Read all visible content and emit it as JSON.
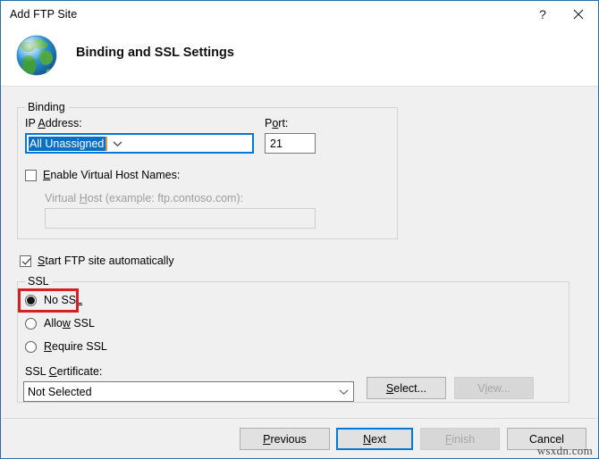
{
  "window": {
    "title": "Add FTP Site",
    "help_icon": "question-mark-icon",
    "close_icon": "close-icon"
  },
  "header": {
    "icon": "globe-icon",
    "title": "Binding and SSL Settings"
  },
  "binding": {
    "legend": "Binding",
    "ip_address_label": "IP Address:",
    "ip_address_value": "All Unassigned",
    "port_label": "Port:",
    "port_value": "21",
    "enable_virtual_host_label": "Enable Virtual Host Names:",
    "enable_virtual_host_checked": false,
    "virtual_host_label": "Virtual Host (example: ftp.contoso.com):",
    "virtual_host_value": "",
    "virtual_host_enabled": false
  },
  "start_automatically": {
    "label": "Start FTP site automatically",
    "checked": true
  },
  "ssl": {
    "legend": "SSL",
    "options": [
      {
        "label": "No SSL",
        "selected": true
      },
      {
        "label": "Allow SSL",
        "selected": false
      },
      {
        "label": "Require SSL",
        "selected": false
      }
    ],
    "certificate_label": "SSL Certificate:",
    "certificate_value": "Not Selected",
    "select_button": "Select...",
    "view_button": "View...",
    "view_enabled": false
  },
  "footer": {
    "previous": "Previous",
    "next": "Next",
    "finish": "Finish",
    "cancel": "Cancel",
    "finish_enabled": false,
    "default_button": "Next"
  },
  "watermark": "wsxdn.com",
  "colors": {
    "accent": "#0078d7",
    "annotation": "#d32121",
    "selection": "#0b6fc4",
    "window_border": "#2e6ca4"
  }
}
